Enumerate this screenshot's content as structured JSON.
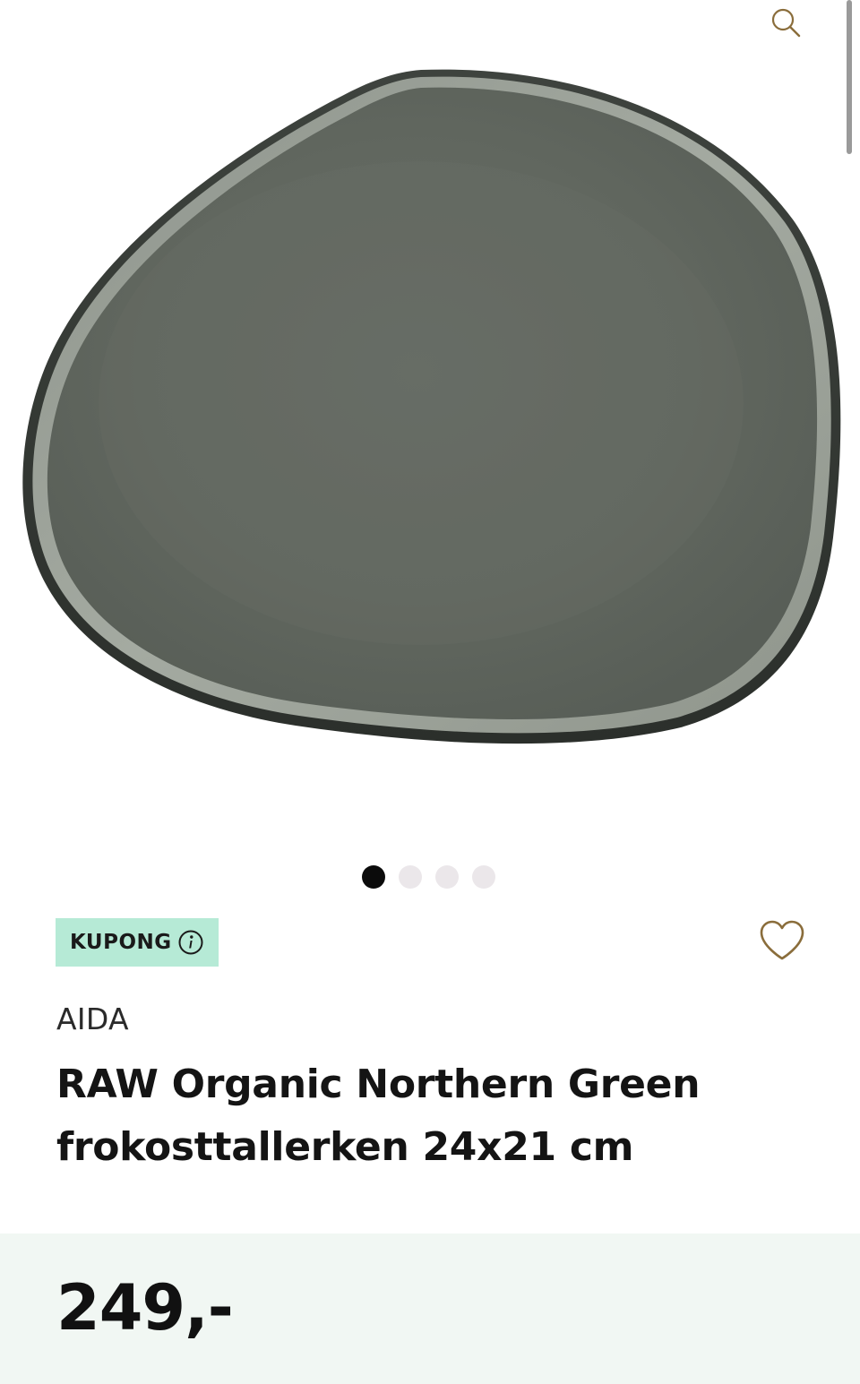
{
  "header": {
    "search_icon": "search-icon"
  },
  "gallery": {
    "image_alt": "RAW Organic Northern Green frokosttallerken",
    "slide_count": 4,
    "active_index": 0
  },
  "badge": {
    "label": "KUPONG",
    "info_icon": "info-icon",
    "background": "#b6ead6"
  },
  "favorite": {
    "icon": "heart-outline-icon",
    "color": "#8a6d3b"
  },
  "product": {
    "brand": "AIDA",
    "title": "RAW Organic Northern Green frokosttallerken 24x21 cm",
    "price": "249,-"
  },
  "colors": {
    "price_band": "#f1f7f3",
    "icon_accent": "#8a6d3b",
    "plate": "#5f655f"
  }
}
